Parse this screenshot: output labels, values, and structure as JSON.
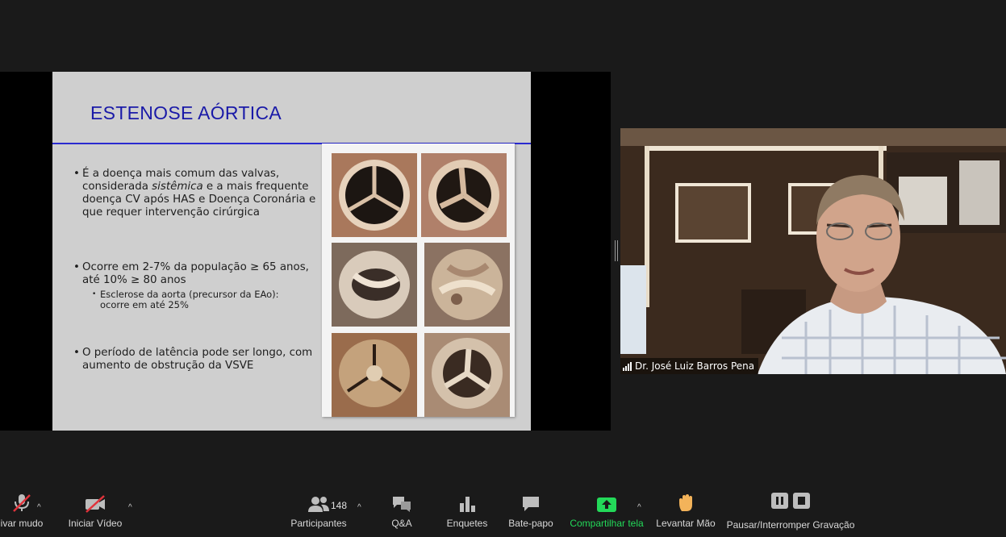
{
  "slide": {
    "title": "ESTENOSE AÓRTICA",
    "bullet1_pre": "É a doença mais comum das valvas, considerada ",
    "bullet1_em": "sistêmica",
    "bullet1_post": " e a mais frequente doença CV após  HAS e Doença  Coronária e que requer intervenção cirúrgica",
    "bullet2": "Ocorre em 2-7% da população ≥ 65 anos, até 10% ≥ 80 anos",
    "bullet2_sub": "Esclerose da aorta (precursor da EAo): ocorre em até 25%",
    "bullet3": "O período de latência pode ser longo, com aumento de obstrução da VSVE",
    "bullet_glyph": "•"
  },
  "participant": {
    "name": "Dr. José Luiz Barros Pena"
  },
  "toolbar": {
    "mute_label": "ivar mudo",
    "video_label": "Iniciar Vídeo",
    "participants_label": "Participantes",
    "participants_count": "148",
    "qa_label": "Q&A",
    "polls_label": "Enquetes",
    "chat_label": "Bate-papo",
    "share_label": "Compartilhar tela",
    "raise_hand_label": "Levantar Mão",
    "recording_label": "Pausar/Interromper Gravação",
    "caret": "^",
    "share_color": "#23d959",
    "muted_color": "#e0333b"
  }
}
